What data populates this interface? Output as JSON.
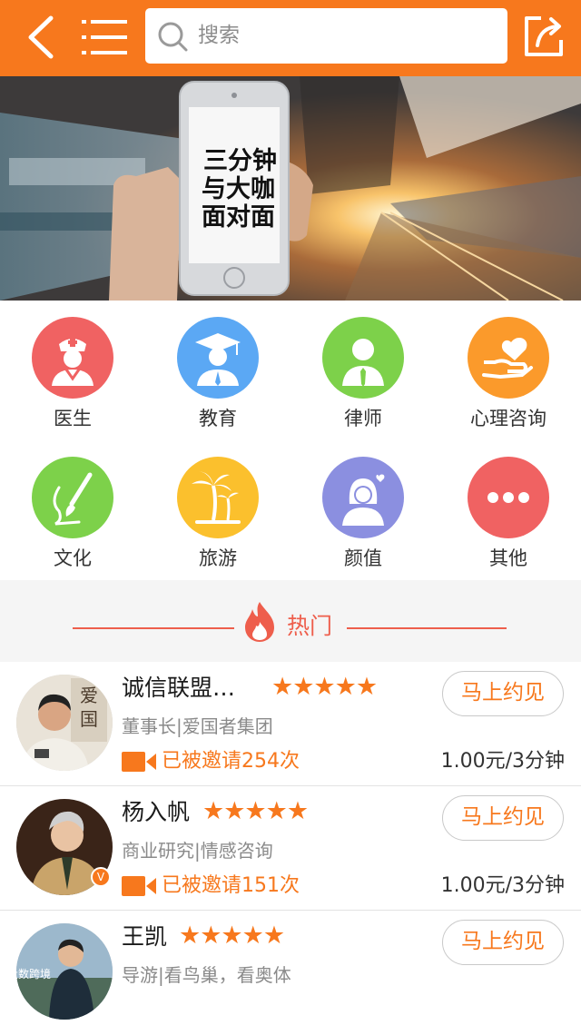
{
  "header": {
    "search_placeholder": "搜索",
    "icons": {
      "back": "back-chevron-icon",
      "menu": "menu-icon",
      "search": "search-icon",
      "share": "share-icon"
    },
    "accent_color": "#f7781d"
  },
  "banner": {
    "phone_text": [
      "三分钟",
      "与大咖",
      "面对面"
    ]
  },
  "categories": [
    {
      "label": "医生",
      "icon": "doctor-icon",
      "color": "#f06262"
    },
    {
      "label": "教育",
      "icon": "graduate-icon",
      "color": "#5ba8f4"
    },
    {
      "label": "律师",
      "icon": "lawyer-icon",
      "color": "#7dd14a"
    },
    {
      "label": "心理咨询",
      "icon": "heart-hand-icon",
      "color": "#fb9a2b"
    },
    {
      "label": "文化",
      "icon": "brush-icon",
      "color": "#7dd14a"
    },
    {
      "label": "旅游",
      "icon": "palm-tree-icon",
      "color": "#fbc02d"
    },
    {
      "label": "颜值",
      "icon": "woman-icon",
      "color": "#8b8fe0"
    },
    {
      "label": "其他",
      "icon": "more-icon",
      "color": "#f06262"
    }
  ],
  "hot_section": {
    "title": "热门",
    "icon": "flame-icon"
  },
  "experts": [
    {
      "name": "诚信联盟…",
      "rating": "★★★★★",
      "desc": "董事长|爱国者集团",
      "invited": "已被邀请254次",
      "price": "1.00元/3分钟",
      "button": "马上约见"
    },
    {
      "name": "杨入帆",
      "rating": "★★★★★",
      "desc": "商业研究|情感咨询",
      "invited": "已被邀请151次",
      "price": "1.00元/3分钟",
      "button": "马上约见"
    },
    {
      "name": "王凯",
      "rating": "★★★★★",
      "desc": "导游|看鸟巢，看奥体",
      "button": "马上约见"
    }
  ],
  "watermark": "大数跨境"
}
